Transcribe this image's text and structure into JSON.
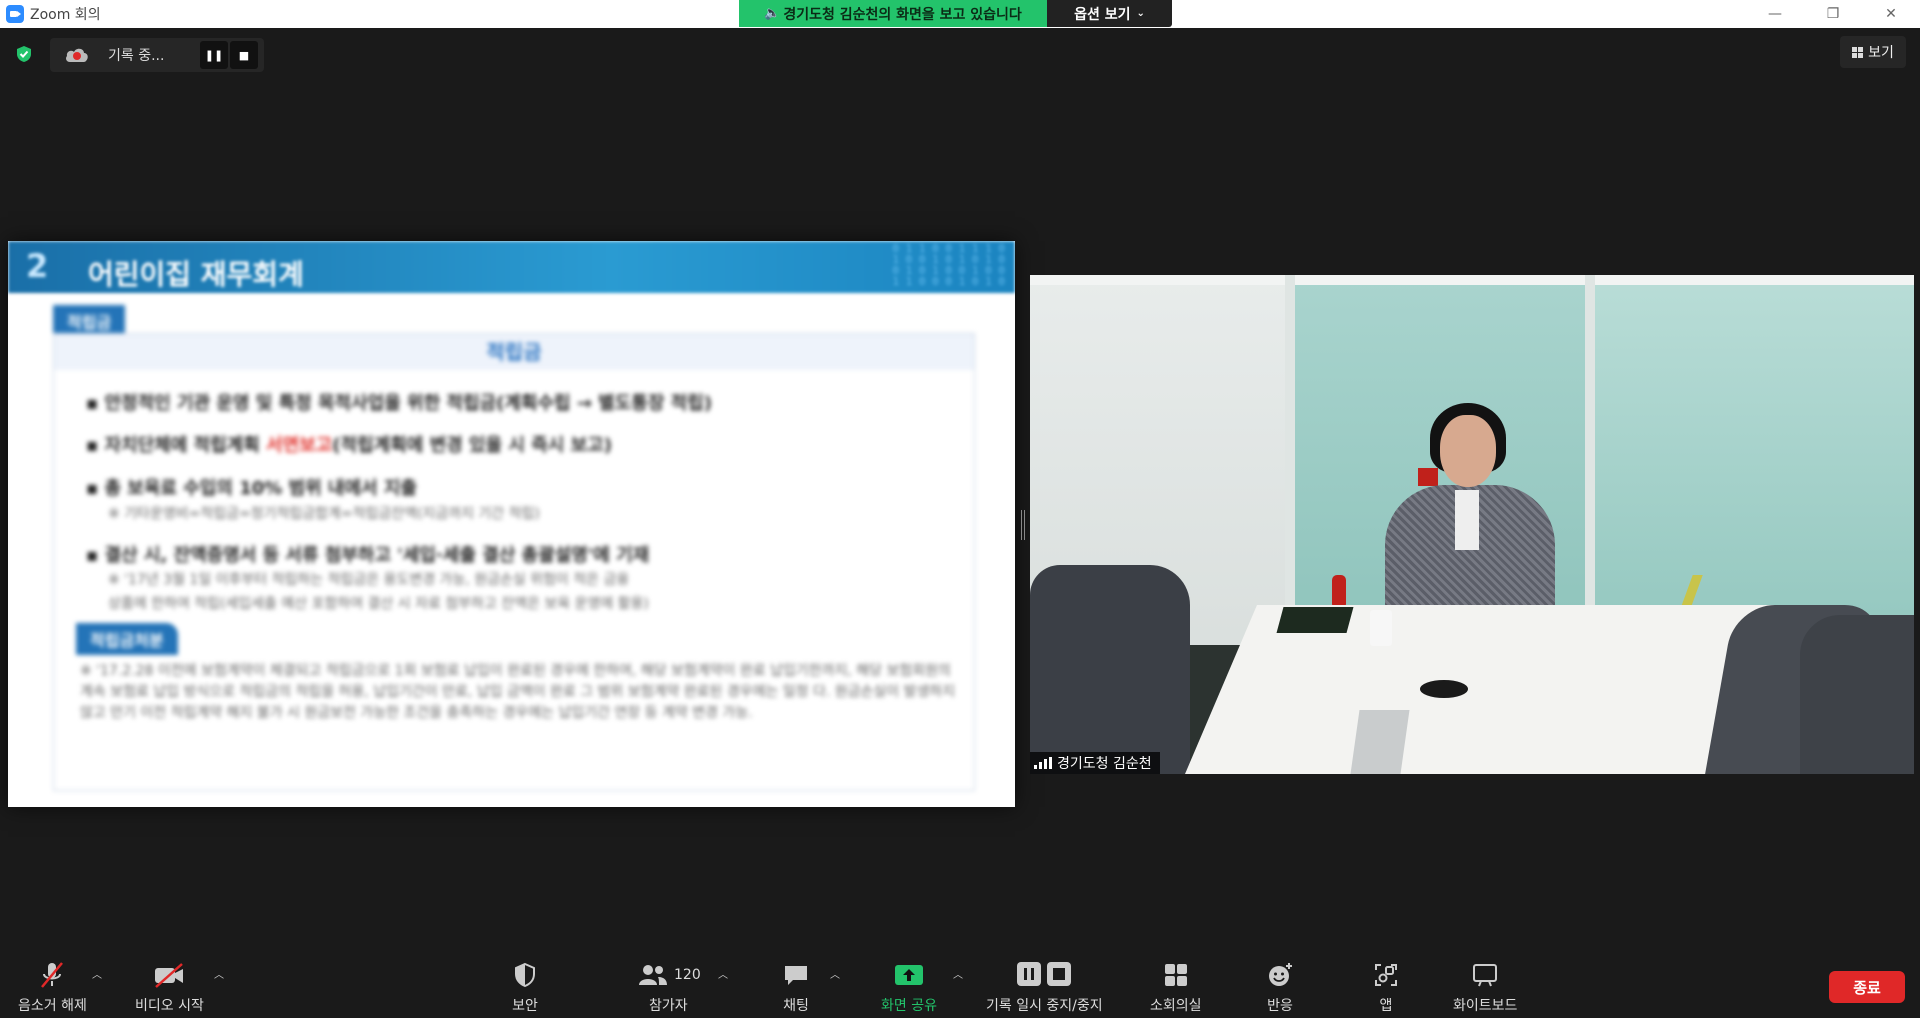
{
  "window": {
    "title": "Zoom 회의",
    "share_banner": "경기도청 김순천의 화면을 보고 있습니다",
    "view_options": "옵션 보기"
  },
  "overlay": {
    "recording_status": "기록 중...",
    "view_label": "보기"
  },
  "shared_slide": {
    "section_number": "2",
    "heading": "어린이집 재무회계",
    "tag1": "적립금",
    "box_title": "적립금",
    "bullets": [
      "안정적인 기관 운영 및 특정 목적사업을 위한 적립금(계획수립 → 별도통장 적립)",
      "자치단체에 적립계획 서면보고(적립계획에 변경 있을 시 즉시 보고)",
      "총 보육료 수입의 10% 범위 내에서 지출",
      "결산 시, 잔액증명서 등 서류 첨부하고 '세입·세출 결산 총괄설명'에 기재"
    ],
    "bullet2_highlight": "서면보고",
    "notes": [
      "※ 기타운영비=적립금=정기적립금합계=적립금잔액(지금까지 기간 적립)",
      "※ '17년 3월 1일 이후부터 적립하는 적립금은 용도변경 가능, 원금손실 위험이 적은 금융",
      "상품에 한하여 적립(세입세출 예산 포함하여 결산 시 자료 첨부하고 잔액은 보육 운영에 활용)"
    ],
    "tag2": "적립금처분",
    "paragraph": "※ '17.2.28 이전에 보험계약이 체결되고 적립금으로 1회 보험료 납입이 완료된 경우에 한하여, 해당 보험계약이 완료 납입기한까지, 해당 보험회원의 계속 보험료 납입 방식으로 적립금의 적립을 허용, 납입기간이 만료, 납입 금액이 완료 그 범위 보험계약 완료된 경우에는 일정 다. 원금손실이 발생하지 않고 만기 이전 적립계약 해지 불가 시 원금보전 가능한 조건을 충족하는 경우에는 납입기간 연장 등 계약 변경 가능."
  },
  "video": {
    "participant_name": "경기도청 김순천"
  },
  "toolbar": {
    "unmute": "음소거 해제",
    "start_video": "비디오 시작",
    "security": "보안",
    "participants": "참가자",
    "participants_count": "120",
    "chat": "채팅",
    "share_screen": "화면 공유",
    "recording": "기록 일시 중지/중지",
    "breakout": "소회의실",
    "reactions": "반응",
    "apps": "앱",
    "whiteboard": "화이트보드",
    "end": "종료"
  },
  "colors": {
    "share_green": "#23c36b",
    "end_red": "#e02828",
    "toolbar_bg": "#1a1a1a"
  }
}
